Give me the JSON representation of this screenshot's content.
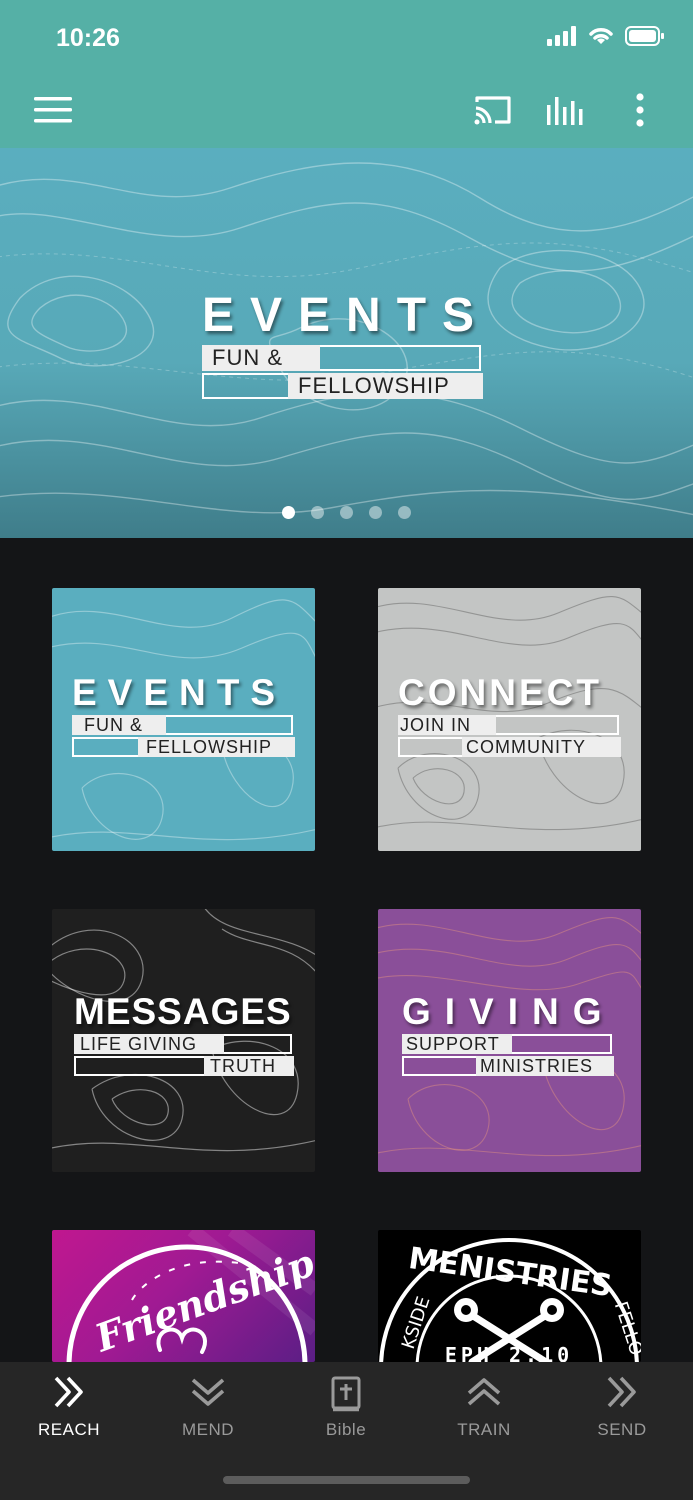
{
  "status": {
    "time": "10:26"
  },
  "colors": {
    "appbar": "#55b0a6",
    "background": "#141517",
    "nav": "#262626",
    "events_teal": "#5aaebf",
    "connect_gray": "#c2c4c3",
    "messages_dark": "#1e1e1e",
    "giving_purple": "#8a4f99"
  },
  "appbar": {
    "menu_icon": "hamburger-icon",
    "cast_icon": "cast-icon",
    "audio_icon": "audio-bars-icon",
    "more_icon": "more-vertical-icon"
  },
  "hero": {
    "title": "EVENTS",
    "line1": "FUN &",
    "line2": "FELLOWSHIP",
    "slide_count": 5,
    "active_slide": 1
  },
  "tiles": [
    {
      "title": "EVENTS",
      "line1": "FUN &",
      "line2": "FELLOWSHIP"
    },
    {
      "title": "CONNECT",
      "line1": "JOIN IN",
      "line2": "COMMUNITY"
    },
    {
      "title": "MESSAGES",
      "line1": "LIFE GIVING",
      "line2": "TRUTH"
    },
    {
      "title": "GIVING",
      "line1": "SUPPORT",
      "line2": "MINISTRIES"
    },
    {
      "title": "Friendship"
    },
    {
      "title": "MENISTRIES",
      "ring_left": "KSIDE",
      "ring_right": "FELLO",
      "verse": "EPH 2:10"
    }
  ],
  "nav": [
    {
      "label": "REACH",
      "icon": "double-chevron-right-icon",
      "active": true
    },
    {
      "label": "MEND",
      "icon": "double-chevron-down-icon",
      "active": false
    },
    {
      "label": "Bible",
      "icon": "bible-icon",
      "active": false
    },
    {
      "label": "TRAIN",
      "icon": "double-chevron-up-icon",
      "active": false
    },
    {
      "label": "SEND",
      "icon": "double-chevron-right-icon",
      "active": false
    }
  ]
}
